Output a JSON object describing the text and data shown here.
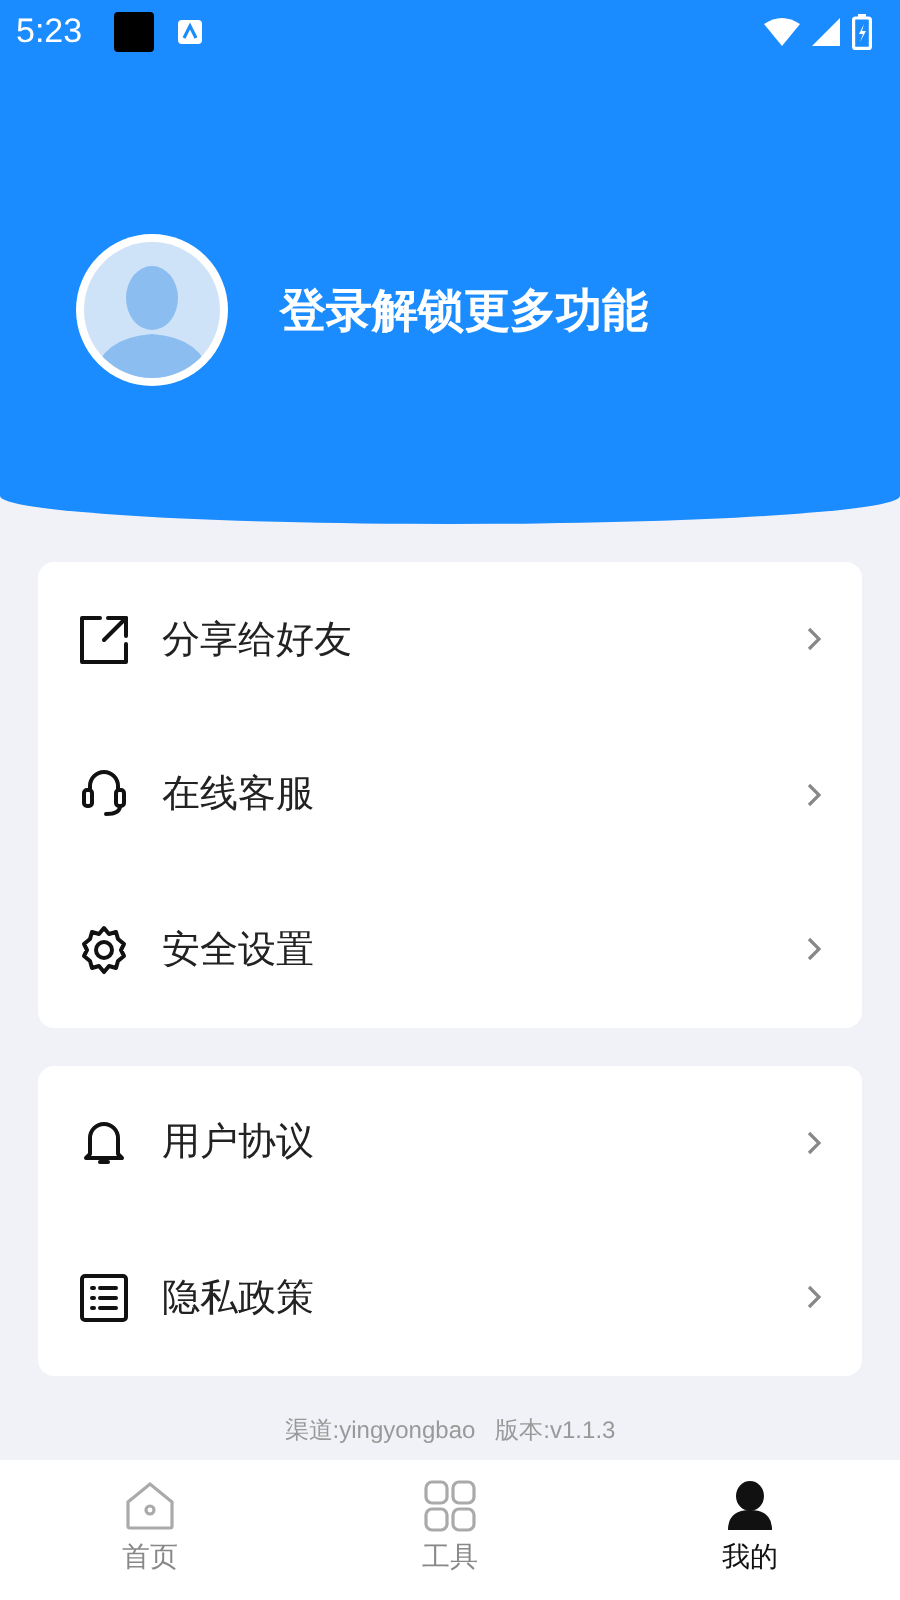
{
  "status_bar": {
    "time": "5:23"
  },
  "header": {
    "login_prompt": "登录解锁更多功能"
  },
  "menu_groups": [
    {
      "items": [
        {
          "label": "分享给好友",
          "kind": "share"
        },
        {
          "label": "在线客服",
          "kind": "headset"
        },
        {
          "label": "安全设置",
          "kind": "gear"
        }
      ]
    },
    {
      "items": [
        {
          "label": "用户协议",
          "kind": "bell"
        },
        {
          "label": "隐私政策",
          "kind": "list"
        }
      ]
    }
  ],
  "footer": {
    "channel": "渠道:yingyongbao",
    "version": "版本:v1.1.3"
  },
  "bottom_nav": [
    {
      "label": "首页",
      "kind": "home",
      "selected": false
    },
    {
      "label": "工具",
      "kind": "grid",
      "selected": false
    },
    {
      "label": "我的",
      "kind": "person",
      "selected": true
    }
  ]
}
